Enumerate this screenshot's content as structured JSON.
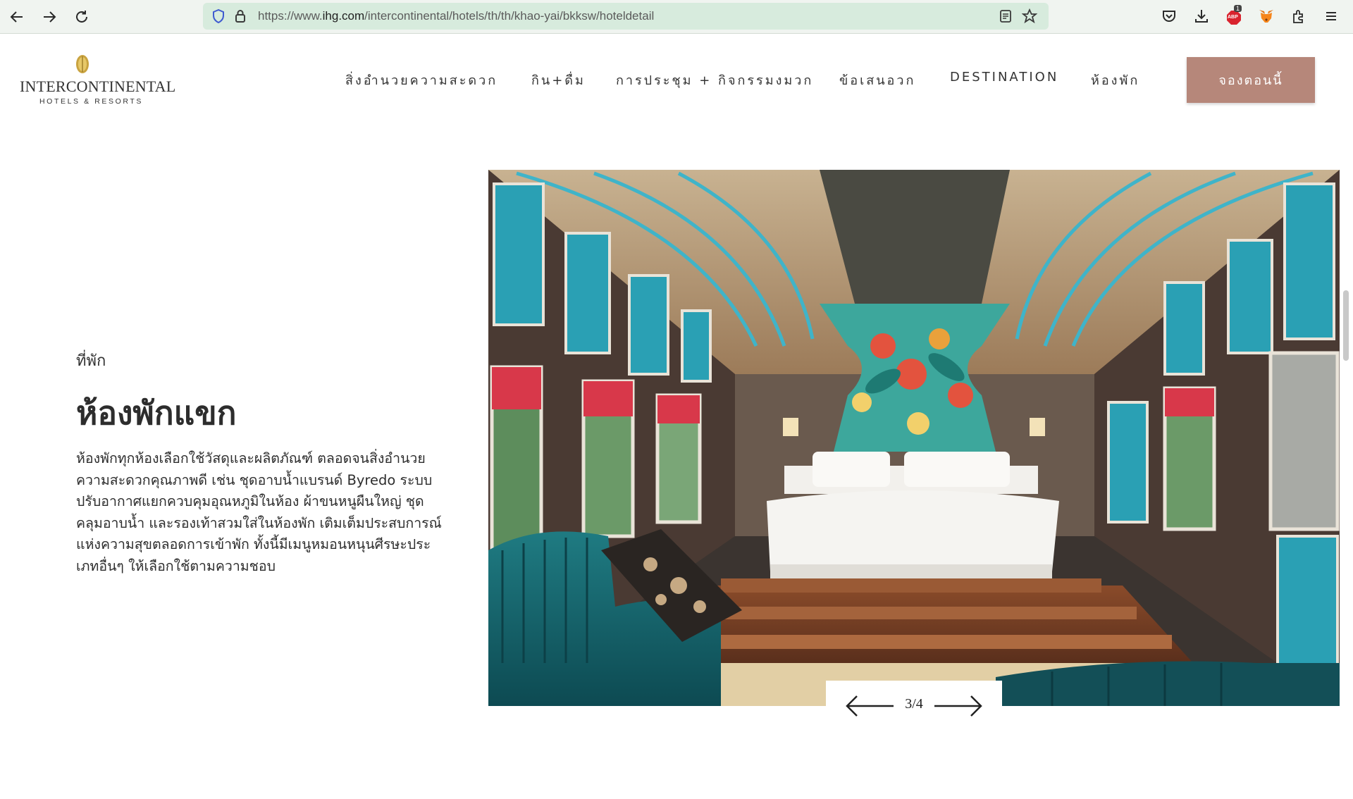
{
  "browser": {
    "url_prefix": "https://www.",
    "url_domain": "ihg.com",
    "url_path": "/intercontinental/hotels/th/th/khao-yai/bkksw/hoteldetail",
    "adblock_badge": "1",
    "adblock_label": "ABP"
  },
  "logo": {
    "brand": "INTERCONTINENTAL",
    "sub": "HOTELS & RESORTS"
  },
  "nav": {
    "items": [
      "สิ่งอำนวยความสะดวก",
      "กิน+ดื่ม",
      "การประชุม + กิจกรรมงมวก",
      "ข้อเสนอวก",
      "DESTINATION",
      "ห้องพัก"
    ],
    "book_label": "จองตอนนี้"
  },
  "content": {
    "eyebrow": "ที่พัก",
    "title": "ห้องพักแขก",
    "description": "ห้องพักทุกห้องเลือกใช้วัสดุและผลิตภัณฑ์ ตลอดจนสิ่งอำนวยความสะดวกคุณภาพดี เช่น ชุดอาบน้ำแบรนด์ Byredo ระบบปรับอากาศแยกควบคุมอุณหภูมิในห้อง ผ้าขนหนูผืนใหญ่ ชุดคลุมอาบน้ำ และรองเท้าสวมใส่ในห้องพัก เติมเต็มประสบการณ์แห่งความสุขตลอดการเข้าพัก ทั้งนี้มีเมนูหมอนหนุนศีรษะประเภทอื่นๆ ให้เลือกใช้ตามความชอบ"
  },
  "carousel": {
    "counter": "3/4"
  },
  "colors": {
    "accent": "#b6877a",
    "urlbar": "#d7ebdd",
    "teal": "#2aa0b4"
  }
}
